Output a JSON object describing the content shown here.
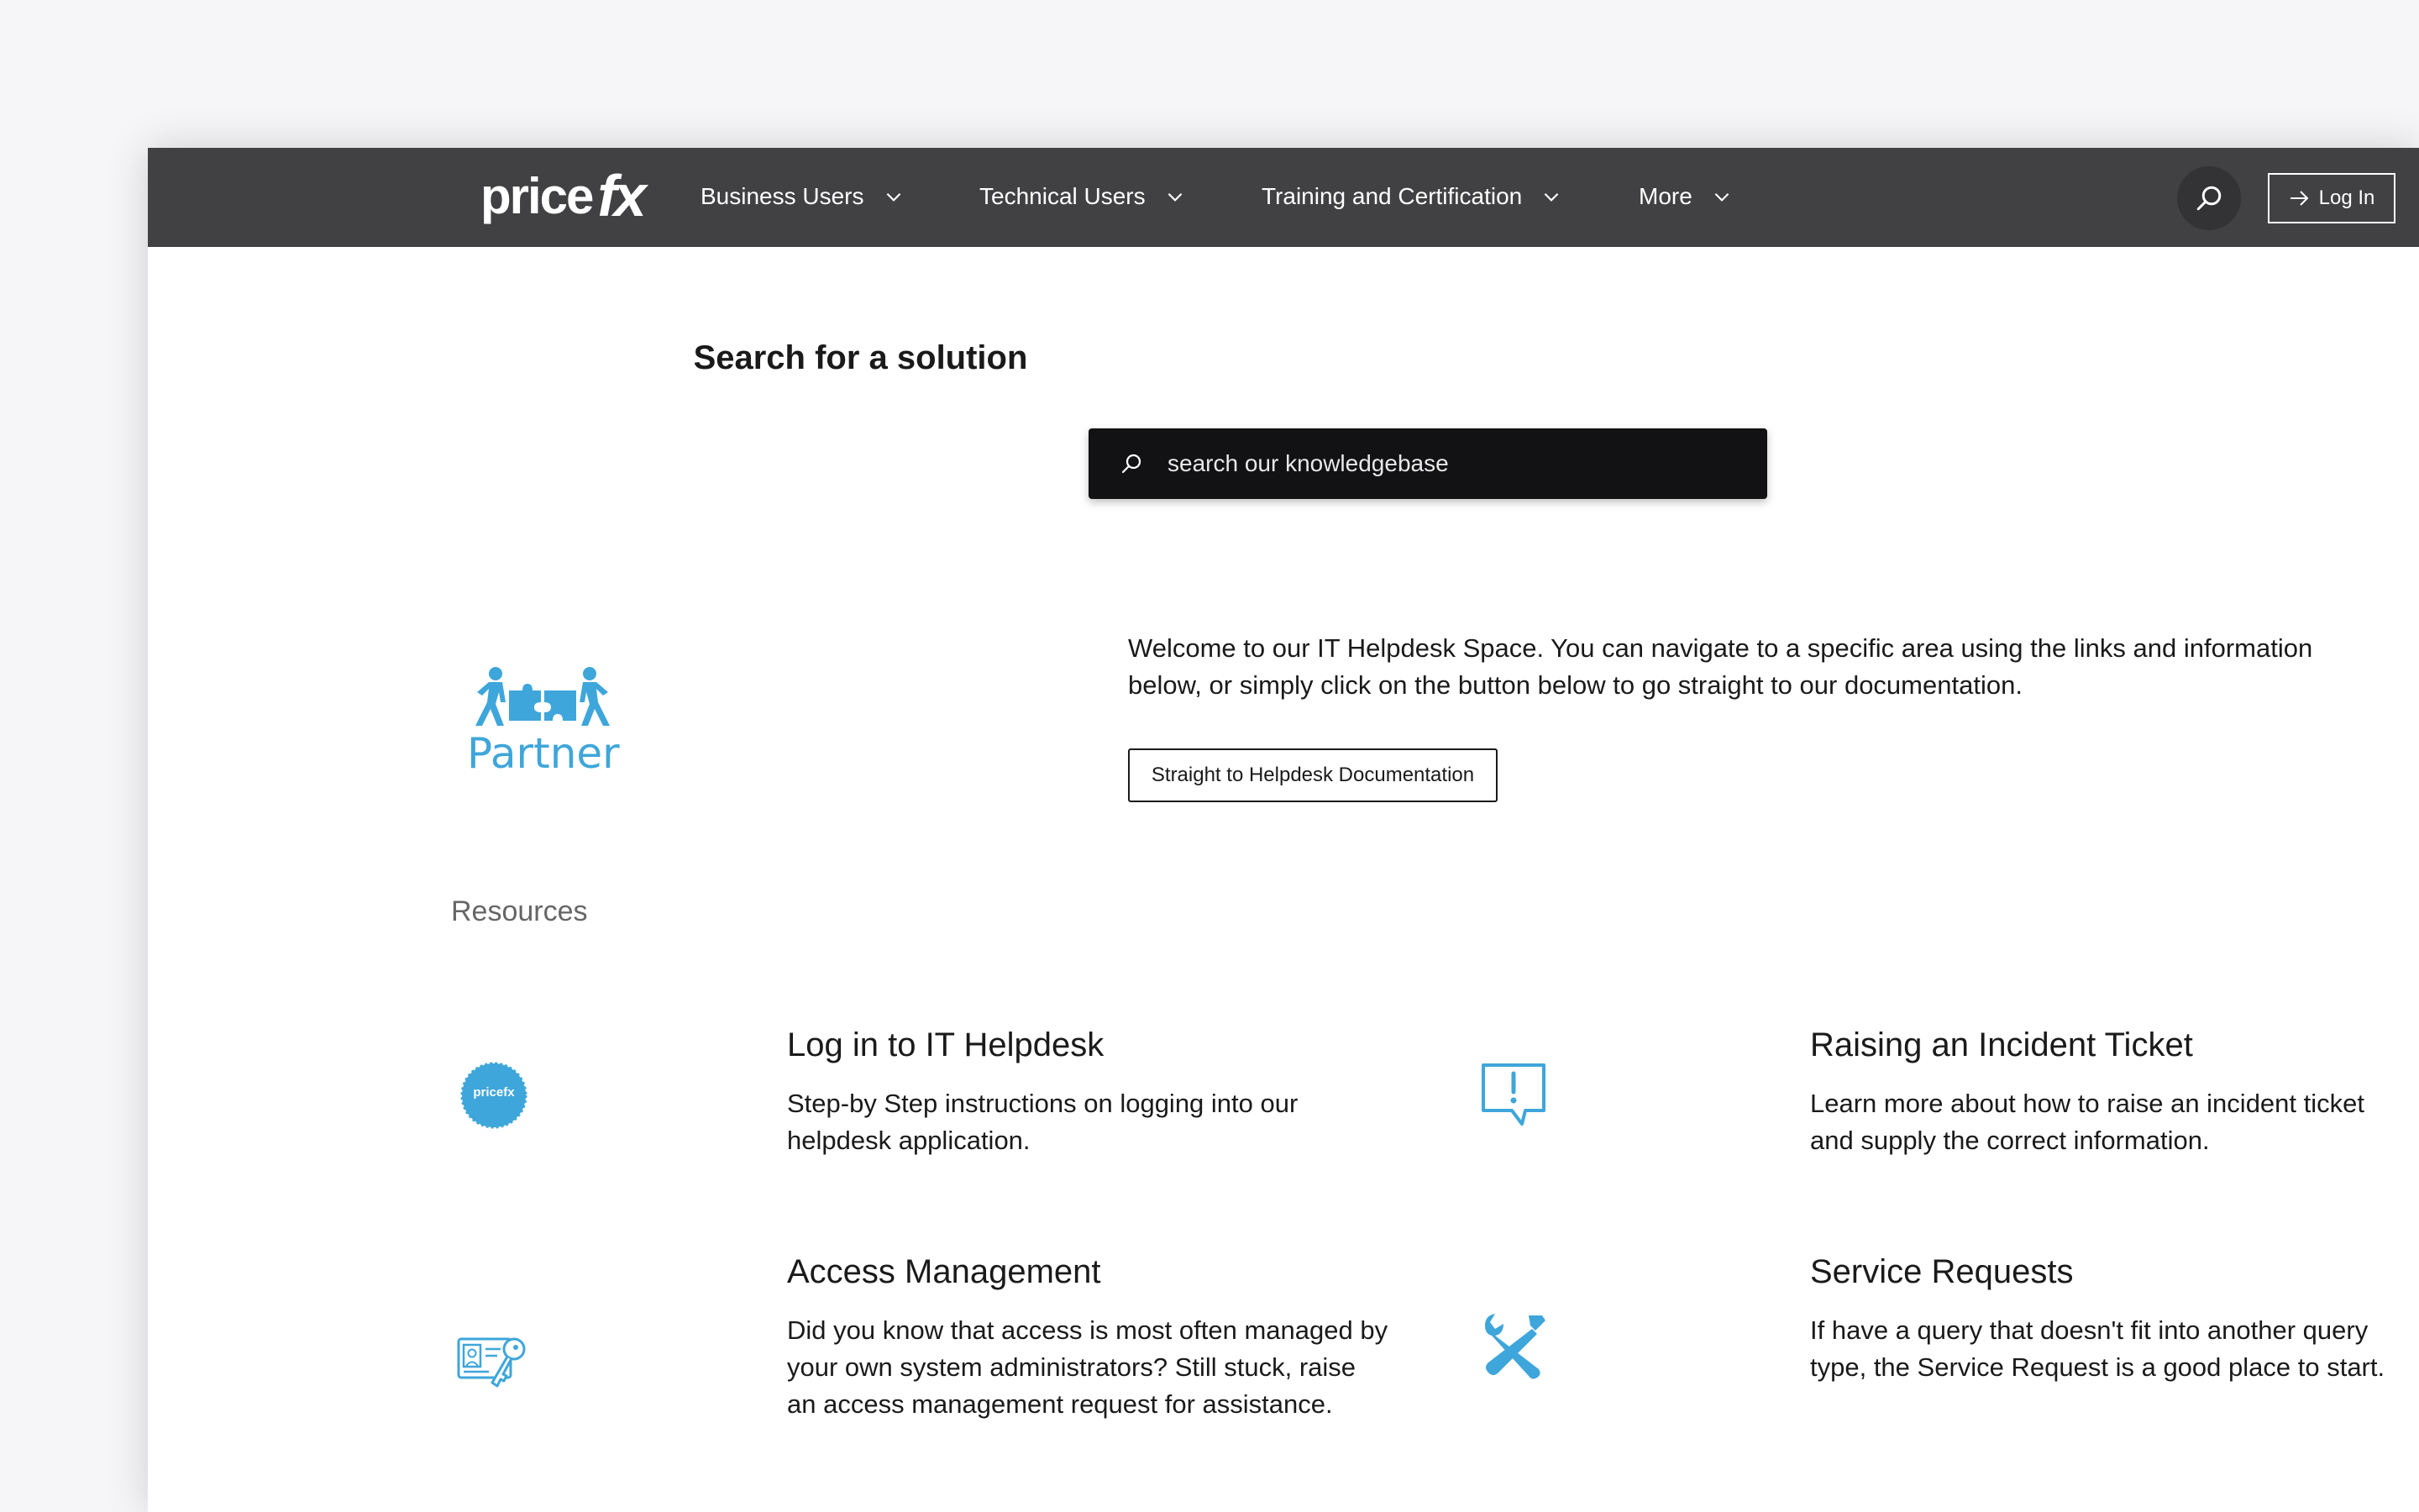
{
  "nav": {
    "logo_price": "price",
    "logo_fx": "fx",
    "items": [
      {
        "label": "Business Users"
      },
      {
        "label": "Technical Users"
      },
      {
        "label": "Training and Certification"
      },
      {
        "label": "More"
      }
    ],
    "login_label": "Log In"
  },
  "search": {
    "title": "Search for a solution",
    "placeholder": "search our knowledgebase"
  },
  "partner": {
    "label": "Partner"
  },
  "welcome": {
    "text": "Welcome to our IT Helpdesk Space. You can navigate to a specific area using the links and information below, or simply click on the button below to go straight to our documentation.",
    "button_label": "Straight to Helpdesk Documentation"
  },
  "resources": {
    "heading": "Resources",
    "cards": [
      {
        "title": "Log in to IT Helpdesk",
        "description": "Step-by Step instructions on logging into our helpdesk application.",
        "icon": "pricefx-badge-icon",
        "badge_text": "pricefx"
      },
      {
        "title": "Raising an Incident Ticket",
        "description": "Learn more about how to raise an incident ticket and supply the correct information.",
        "icon": "speech-bubble-exclamation-icon"
      },
      {
        "title": "Access Management",
        "description": "Did you know that access is most often managed by your own system administrators? Still stuck, raise an access management request for assistance.",
        "icon": "id-card-key-icon"
      },
      {
        "title": "Service Requests",
        "description": "If have a query that doesn't fit into another query type, the Service Request is a good place to start.",
        "icon": "wrench-screwdriver-icon"
      }
    ]
  },
  "colors": {
    "navbar": "#414042",
    "accent": "#3ea6da",
    "search_box": "#121113"
  }
}
